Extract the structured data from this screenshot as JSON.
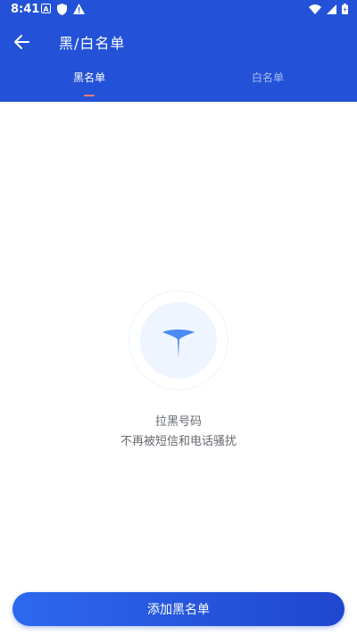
{
  "status_bar": {
    "time": "8:41",
    "notification_icons": [
      "a-icon",
      "shield-icon",
      "warning-icon"
    ],
    "system_icons": [
      "wifi-icon",
      "signal-icon",
      "battery-icon"
    ]
  },
  "toolbar": {
    "title": "黑/白名单",
    "back_icon": "arrow-left-icon"
  },
  "tabs": [
    {
      "label": "黑名单",
      "active": true
    },
    {
      "label": "白名单",
      "active": false
    }
  ],
  "empty_state": {
    "icon": "pin-icon",
    "title": "拉黑号码",
    "subtitle": "不再被短信和电话骚扰"
  },
  "add_button": {
    "label": "添加黑名单"
  },
  "colors": {
    "header": "#2352d8",
    "tab_indicator": "#f37b7b",
    "button_start": "#2d69ee",
    "button_end": "#2046cf",
    "icon_blue": "#4a8bf5",
    "empty_circle": "#eef5ff"
  }
}
